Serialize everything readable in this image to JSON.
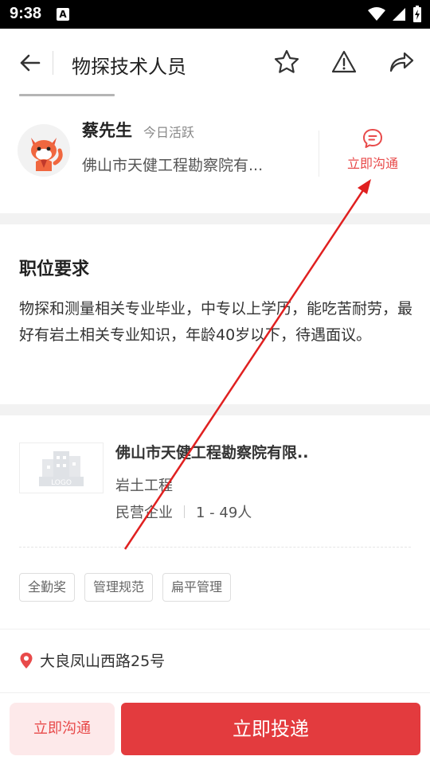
{
  "status_bar": {
    "time": "9:38",
    "a_label": "A"
  },
  "header": {
    "title": "物探技术人员"
  },
  "recruiter": {
    "name": "蔡先生",
    "active": "今日活跃",
    "company": "佛山市天健工程勘察院有...",
    "chat_label": "立即沟通"
  },
  "requirements": {
    "title": "职位要求",
    "text": "物探和测量相关专业毕业，中专以上学历，能吃苦耐劳，最好有岩土相关专业知识，年龄40岁以下，待遇面议。"
  },
  "company": {
    "logo_text": "LOGO",
    "name": "佛山市天健工程勘察院有限..",
    "industry": "岩土工程",
    "type": "民营企业",
    "size": "1 - 49人"
  },
  "tags": [
    "全勤奖",
    "管理规范",
    "扁平管理"
  ],
  "address": "大良凤山西路25号",
  "bottom": {
    "chat": "立即沟通",
    "apply": "立即投递"
  },
  "colors": {
    "accent": "#e33b3e",
    "accent_light": "#fde9ea",
    "arrow": "#e02020"
  }
}
